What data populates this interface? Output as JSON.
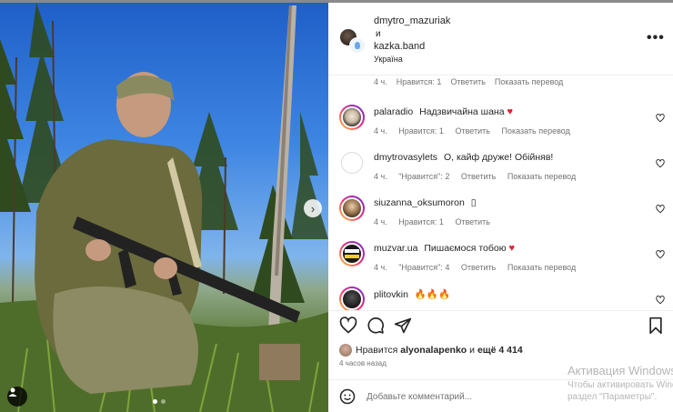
{
  "post": {
    "author": "dmytro_mazuriak",
    "and_text": "и",
    "collaborator": "kazka.band",
    "location": "Україна",
    "more_icon": "more-horizontal-icon"
  },
  "first_meta": {
    "time": "4 ч.",
    "likes": "Нравится: 1",
    "reply": "Ответить",
    "translate": "Показать перевод"
  },
  "comments": [
    {
      "user": "palaradio",
      "text": "Надзвичайна шана",
      "emoji": "♥",
      "time": "4 ч.",
      "likes": "Нравится: 1",
      "reply": "Ответить",
      "translate": "Показать перевод"
    },
    {
      "user": "dmytrovasylets",
      "text": "О, кайф друже! Обійняв!",
      "emoji": "",
      "time": "4 ч.",
      "likes": "\"Нравится\": 2",
      "reply": "Ответить",
      "translate": "Показать перевод"
    },
    {
      "user": "siuzanna_oksumoron",
      "text": "▯",
      "emoji": "",
      "time": "4 ч.",
      "likes": "Нравится: 1",
      "reply": "Ответить",
      "translate": ""
    },
    {
      "user": "muzvar.ua",
      "text": "Пишаємося тобою",
      "emoji": "♥",
      "time": "4 ч.",
      "likes": "\"Нравится\": 4",
      "reply": "Ответить",
      "translate": "Показать перевод"
    },
    {
      "user": "plitovkin",
      "text": "🔥🔥🔥",
      "emoji": "",
      "time": "",
      "likes": "",
      "reply": "",
      "translate": ""
    }
  ],
  "actions": {
    "likes_prefix": "Нравится",
    "likes_user": "alyonalapenko",
    "likes_middle": "и",
    "likes_more": "ещё 4 414",
    "time_ago": "4 часов назад"
  },
  "add_comment": {
    "placeholder": "Добавьте комментарий..."
  },
  "windows_watermark": {
    "title": "Активация Windows",
    "line1": "Чтобы активировать Windows,",
    "line2": "раздел \"Параметры\"."
  },
  "colors": {
    "heart": "#e0222f",
    "story_ring": [
      "#f9ce34",
      "#ee2a7b",
      "#6228d7"
    ]
  }
}
